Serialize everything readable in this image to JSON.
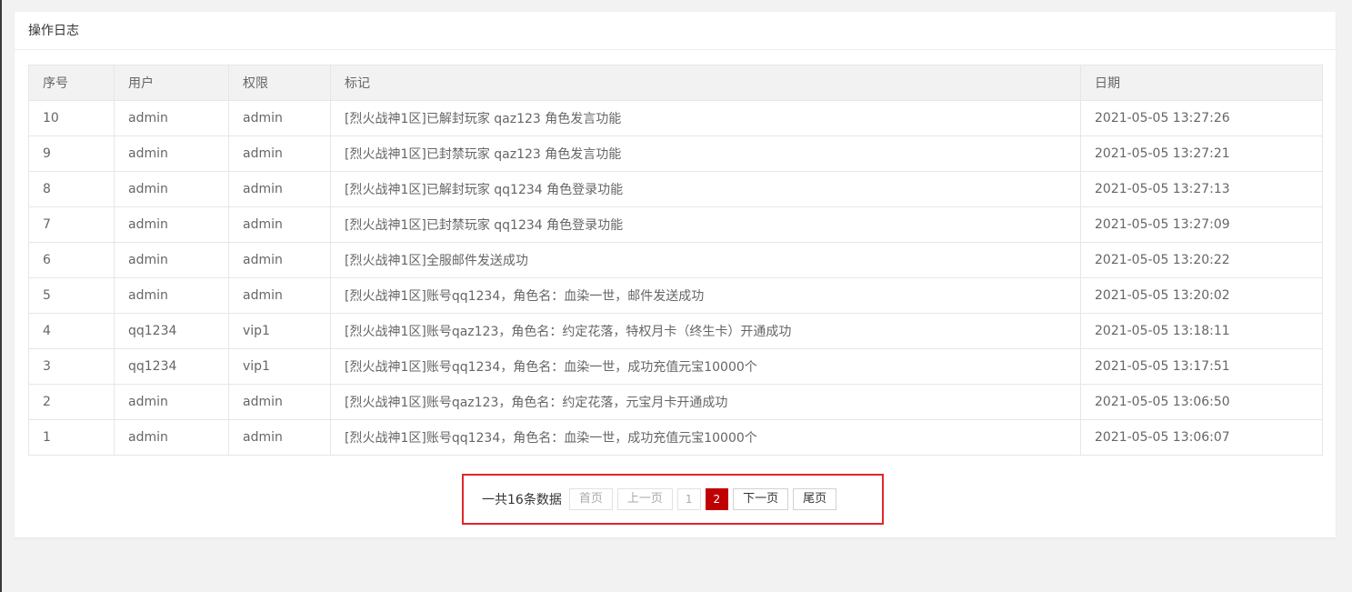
{
  "card": {
    "title": "操作日志"
  },
  "table": {
    "headers": [
      "序号",
      "用户",
      "权限",
      "标记",
      "日期"
    ],
    "rows": [
      {
        "id": "10",
        "user": "admin",
        "role": "admin",
        "mark": "[烈火战神1区]已解封玩家 qaz123 角色发言功能",
        "date": "2021-05-05 13:27:26"
      },
      {
        "id": "9",
        "user": "admin",
        "role": "admin",
        "mark": "[烈火战神1区]已封禁玩家 qaz123 角色发言功能",
        "date": "2021-05-05 13:27:21"
      },
      {
        "id": "8",
        "user": "admin",
        "role": "admin",
        "mark": "[烈火战神1区]已解封玩家 qq1234 角色登录功能",
        "date": "2021-05-05 13:27:13"
      },
      {
        "id": "7",
        "user": "admin",
        "role": "admin",
        "mark": "[烈火战神1区]已封禁玩家 qq1234 角色登录功能",
        "date": "2021-05-05 13:27:09"
      },
      {
        "id": "6",
        "user": "admin",
        "role": "admin",
        "mark": "[烈火战神1区]全服邮件发送成功",
        "date": "2021-05-05 13:20:22"
      },
      {
        "id": "5",
        "user": "admin",
        "role": "admin",
        "mark": "[烈火战神1区]账号qq1234，角色名：血染一世，邮件发送成功",
        "date": "2021-05-05 13:20:02"
      },
      {
        "id": "4",
        "user": "qq1234",
        "role": "vip1",
        "mark": "[烈火战神1区]账号qaz123，角色名：约定花落，特权月卡（终生卡）开通成功",
        "date": "2021-05-05 13:18:11"
      },
      {
        "id": "3",
        "user": "qq1234",
        "role": "vip1",
        "mark": "[烈火战神1区]账号qq1234，角色名：血染一世，成功充值元宝10000个",
        "date": "2021-05-05 13:17:51"
      },
      {
        "id": "2",
        "user": "admin",
        "role": "admin",
        "mark": "[烈火战神1区]账号qaz123，角色名：约定花落，元宝月卡开通成功",
        "date": "2021-05-05 13:06:50"
      },
      {
        "id": "1",
        "user": "admin",
        "role": "admin",
        "mark": "[烈火战神1区]账号qq1234，角色名：血染一世，成功充值元宝10000个",
        "date": "2021-05-05 13:06:07"
      }
    ]
  },
  "pagination": {
    "total_text": "一共16条数据",
    "first_label": "首页",
    "prev_label": "上一页",
    "pages": [
      "1",
      "2"
    ],
    "current_page": "2",
    "next_label": "下一页",
    "last_label": "尾页"
  },
  "colors": {
    "highlight_border": "#e0262b",
    "current_page_bg": "#c00000"
  }
}
